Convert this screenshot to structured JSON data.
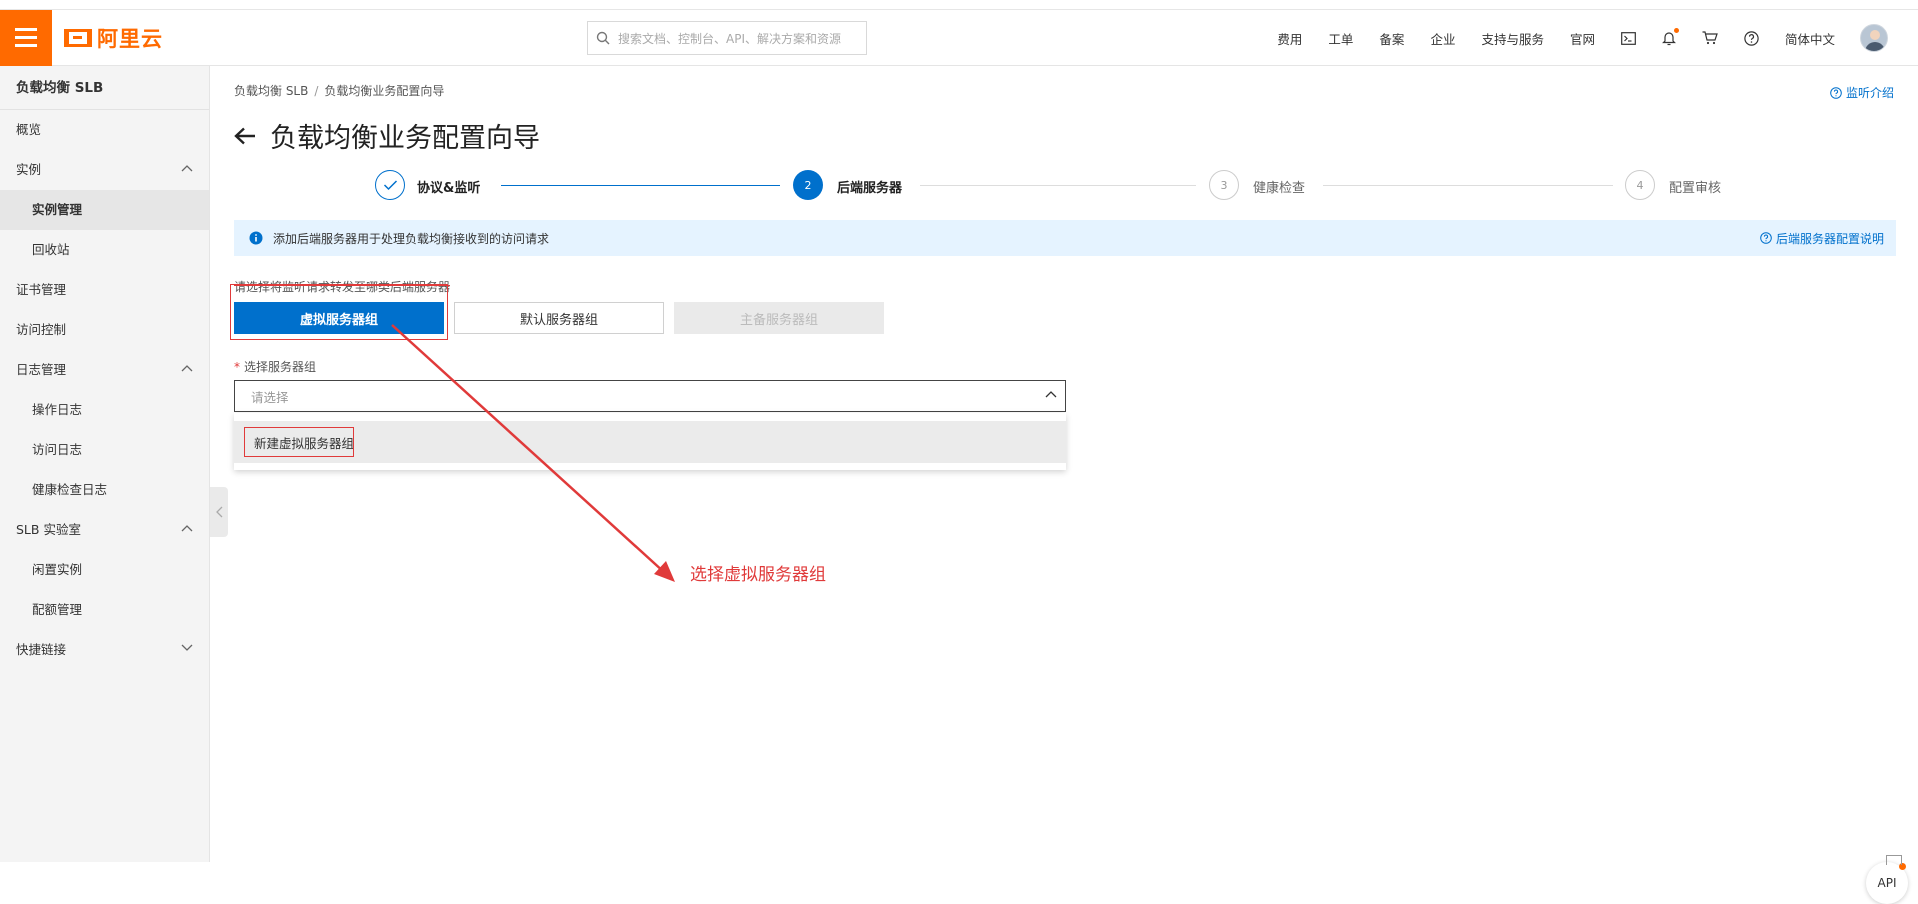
{
  "topbar": {
    "brand": "阿里云",
    "search_placeholder": "搜索文档、控制台、API、解决方案和资源",
    "nav": [
      "费用",
      "工单",
      "备案",
      "企业",
      "支持与服务",
      "官网"
    ],
    "language": "简体中文"
  },
  "sidebar": {
    "title": "负载均衡 SLB",
    "items": [
      {
        "label": "概览"
      },
      {
        "label": "实例"
      },
      {
        "label": "实例管理"
      },
      {
        "label": "回收站"
      },
      {
        "label": "证书管理"
      },
      {
        "label": "访问控制"
      },
      {
        "label": "日志管理"
      },
      {
        "label": "操作日志"
      },
      {
        "label": "访问日志"
      },
      {
        "label": "健康检查日志"
      },
      {
        "label": "SLB 实验室"
      },
      {
        "label": "闲置实例"
      },
      {
        "label": "配额管理"
      },
      {
        "label": "快捷链接"
      }
    ]
  },
  "breadcrumb": [
    "负载均衡 SLB",
    "负载均衡业务配置向导"
  ],
  "help_link": "监听介绍",
  "page_title": "负载均衡业务配置向导",
  "steps": [
    {
      "number": "",
      "label": "协议&监听",
      "state": "done"
    },
    {
      "number": "2",
      "label": "后端服务器",
      "state": "current"
    },
    {
      "number": "3",
      "label": "健康检查",
      "state": "todo"
    },
    {
      "number": "4",
      "label": "配置审核",
      "state": "todo"
    }
  ],
  "info": {
    "message": "添加后端服务器用于处理负载均衡接收到的访问请求",
    "link": "后端服务器配置说明"
  },
  "server_type": {
    "prompt": "请选择将监听请求转发至哪类后端服务器",
    "options": [
      "虚拟服务器组",
      "默认服务器组",
      "主备服务器组"
    ],
    "selected": "虚拟服务器组"
  },
  "server_group": {
    "label": "选择服务器组",
    "required_mark": "*",
    "placeholder": "请选择",
    "dropdown_option": "新建虚拟服务器组"
  },
  "annotation": "选择虚拟服务器组",
  "float_button": "API",
  "colors": {
    "brand": "#ff6a00",
    "primary": "#0070cc",
    "annotation": "#e03a3a",
    "info_bg": "#e5f3ff"
  }
}
